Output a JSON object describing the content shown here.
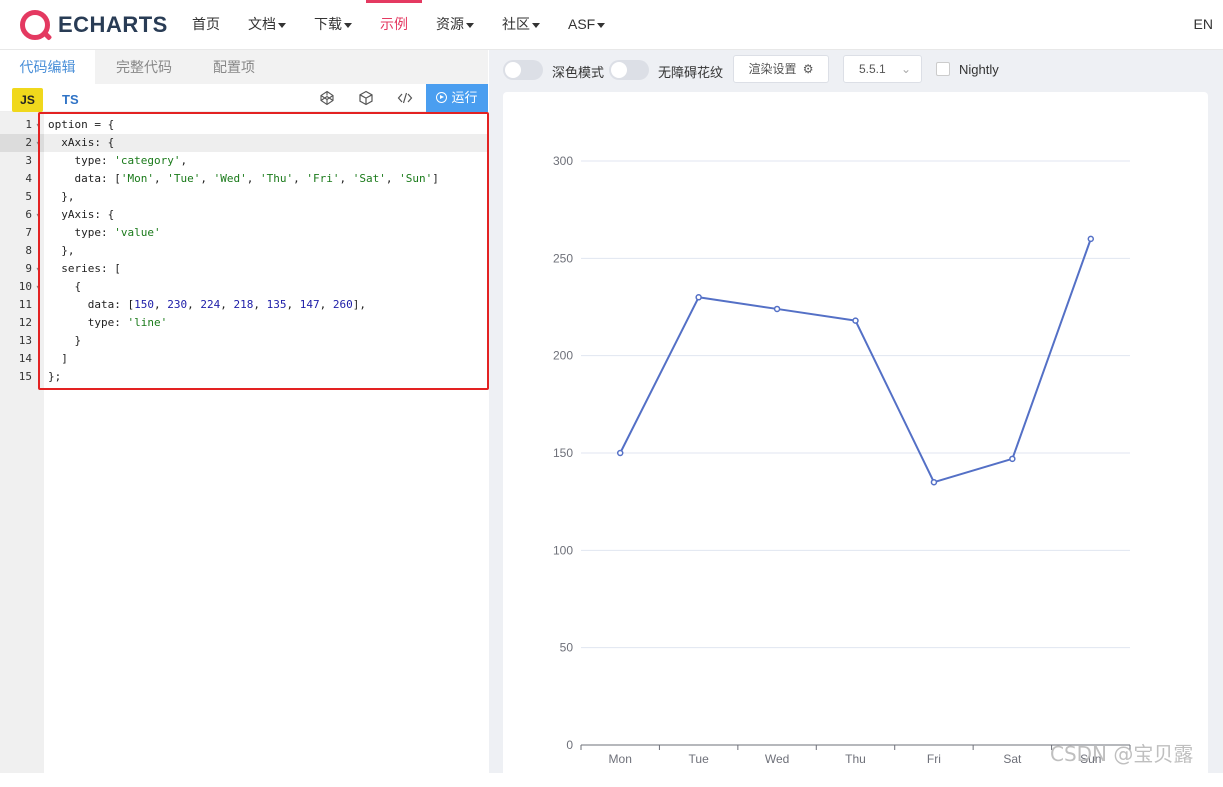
{
  "nav": {
    "logo_text": "ECHARTS",
    "items": [
      {
        "label": "首页",
        "caret": false,
        "active": false
      },
      {
        "label": "文档",
        "caret": true,
        "active": false
      },
      {
        "label": "下载",
        "caret": true,
        "active": false
      },
      {
        "label": "示例",
        "caret": false,
        "active": true
      },
      {
        "label": "资源",
        "caret": true,
        "active": false
      },
      {
        "label": "社区",
        "caret": true,
        "active": false
      },
      {
        "label": "ASF",
        "caret": true,
        "active": false
      }
    ],
    "lang_switch": "EN"
  },
  "editor": {
    "tabs": [
      "代码编辑",
      "完整代码",
      "配置项"
    ],
    "active_tab": 0,
    "lang_js": "JS",
    "lang_ts": "TS",
    "icons": [
      "codepen-icon",
      "codesandbox-icon",
      "code-icon"
    ],
    "run_label": "运行",
    "highlight_line": 2,
    "lines": [
      "option = {",
      "  xAxis: {",
      "    type: 'category',",
      "    data: ['Mon', 'Tue', 'Wed', 'Thu', 'Fri', 'Sat', 'Sun']",
      "  },",
      "  yAxis: {",
      "    type: 'value'",
      "  },",
      "  series: [",
      "    {",
      "      data: [150, 230, 224, 218, 135, 147, 260],",
      "      type: 'line'",
      "    }",
      "  ]",
      "};"
    ]
  },
  "preview": {
    "dark_mode_label": "深色模式",
    "a11y_label": "无障碍花纹",
    "render_settings_label": "渲染设置",
    "version": "5.5.1",
    "nightly_label": "Nightly"
  },
  "watermark": "CSDN @宝贝露",
  "colors": {
    "accent": "#e43961",
    "run": "#4a9ef0",
    "series": "#5470c6",
    "highlight_box": "#e32222"
  },
  "chart_data": {
    "type": "line",
    "categories": [
      "Mon",
      "Tue",
      "Wed",
      "Thu",
      "Fri",
      "Sat",
      "Sun"
    ],
    "series": [
      {
        "values": [
          150,
          230,
          224,
          218,
          135,
          147,
          260
        ]
      }
    ],
    "ylim": [
      0,
      300
    ],
    "yticks": [
      0,
      50,
      100,
      150,
      200,
      250,
      300
    ],
    "grid": true
  }
}
